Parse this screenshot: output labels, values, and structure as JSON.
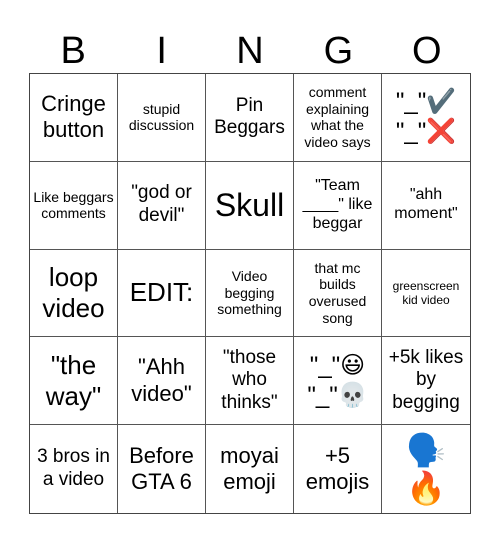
{
  "header": {
    "letters": [
      "B",
      "I",
      "N",
      "G",
      "O"
    ]
  },
  "cells": [
    {
      "text": "Cringe button"
    },
    {
      "text": "stupid discussion"
    },
    {
      "text": "Pin Beggars"
    },
    {
      "text": "comment explaining what the video says"
    },
    {
      "lines": [
        "\"_\"✔️",
        "\"_\"❌"
      ],
      "icons": [
        "check-mark-icon",
        "cross-mark-icon"
      ]
    },
    {
      "text": "Like beggars comments"
    },
    {
      "text": "\"god or devil\""
    },
    {
      "text": "Skull"
    },
    {
      "text": "\"Team ____\" like beggar"
    },
    {
      "text": "\"ahh moment\""
    },
    {
      "text": "loop video"
    },
    {
      "text": "EDIT:"
    },
    {
      "text": "Video begging something"
    },
    {
      "text": "that mc builds overused song"
    },
    {
      "text": "greenscreen kid video"
    },
    {
      "text": "\"the way\""
    },
    {
      "text": "\"Ahh video\""
    },
    {
      "text": "\"those who thinks\""
    },
    {
      "lines": [
        "\"_\"😃",
        "\"_\"💀"
      ],
      "icons": [
        "grinning-face-icon",
        "skull-icon"
      ]
    },
    {
      "text": "+5k likes by begging"
    },
    {
      "text": "3 bros in a video"
    },
    {
      "text": "Before GTA 6"
    },
    {
      "text": "moyai emoji"
    },
    {
      "text": "+5 emojis"
    },
    {
      "lines": [
        "🗣️",
        "🔥"
      ],
      "icons": [
        "speaking-head-icon",
        "fire-icon"
      ]
    }
  ]
}
